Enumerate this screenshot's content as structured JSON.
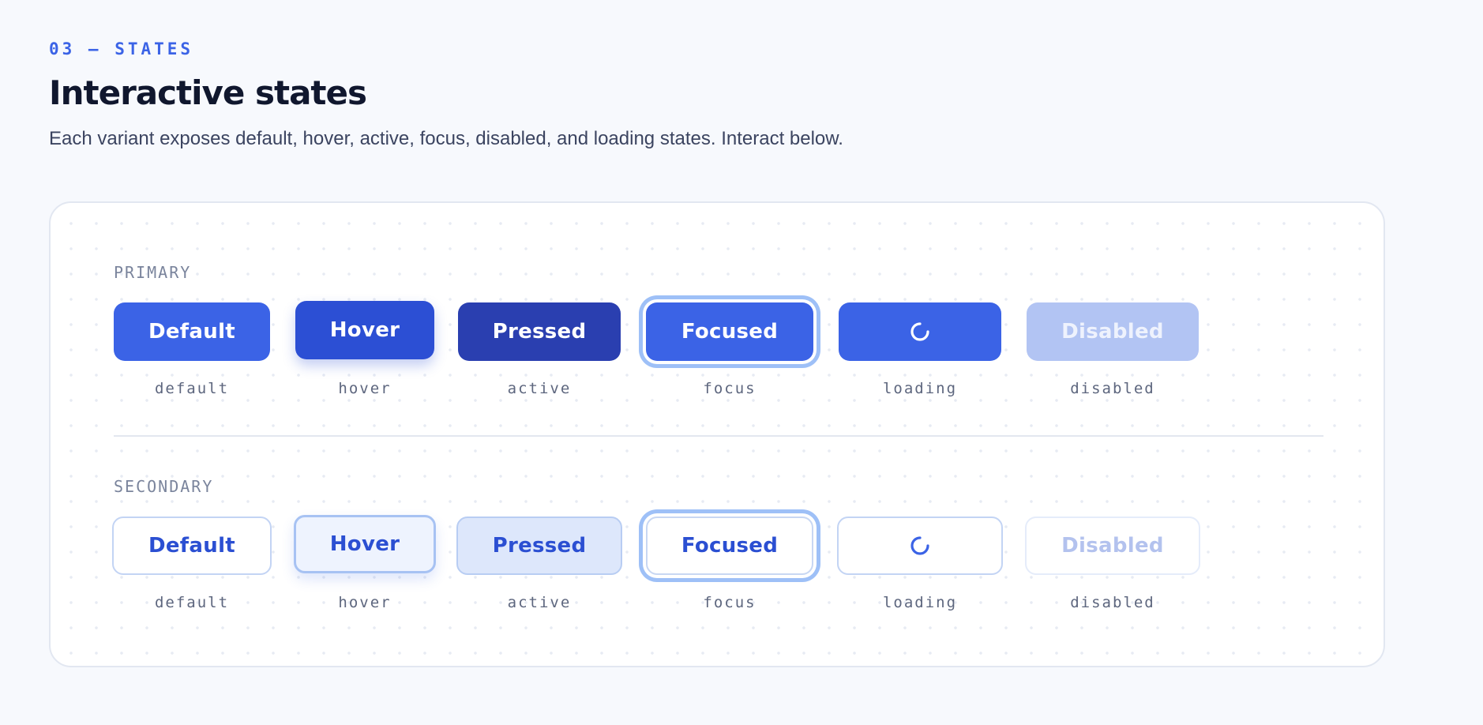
{
  "header": {
    "eyebrow": "03 — STATES",
    "title": "Interactive states",
    "subtitle": "Each variant exposes default, hover, active, focus, disabled, and loading states. Interact below."
  },
  "primary": {
    "label": "PRIMARY",
    "buttons": [
      {
        "text": "Default",
        "state": "default"
      },
      {
        "text": "Hover",
        "state": "hover"
      },
      {
        "text": "Pressed",
        "state": "active"
      },
      {
        "text": "Focused",
        "state": "focus"
      },
      {
        "text": "",
        "state": "loading"
      },
      {
        "text": "Disabled",
        "state": "disabled"
      }
    ]
  },
  "secondary": {
    "label": "SECONDARY",
    "buttons": [
      {
        "text": "Default",
        "state": "default"
      },
      {
        "text": "Hover",
        "state": "hover"
      },
      {
        "text": "Pressed",
        "state": "active"
      },
      {
        "text": "Focused",
        "state": "focus"
      },
      {
        "text": "",
        "state": "loading"
      },
      {
        "text": "Disabled",
        "state": "disabled"
      }
    ]
  },
  "colors": {
    "accent": "#3b63e6",
    "primary_hover": "#2c4fd4",
    "primary_pressed": "#2a3fb0",
    "focus_ring": "#9ec0f7",
    "primary_disabled": "#b2c4f3",
    "secondary_text": "#2b4fd2",
    "secondary_border": "#c3d4f4",
    "secondary_pressed_bg": "#dde7fb",
    "page_background": "#f7f9fd"
  },
  "icons": {
    "loading": "spinner-icon"
  }
}
